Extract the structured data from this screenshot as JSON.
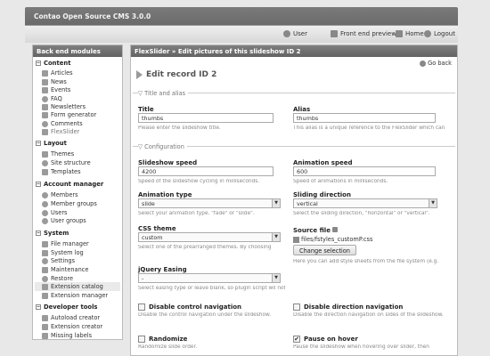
{
  "header": {
    "app_title": "Contao Open Source CMS 3.0.0",
    "nav": [
      {
        "label": "User",
        "icon": "user-icon"
      },
      {
        "label": "Front end preview",
        "icon": "preview-icon"
      },
      {
        "label": "Home",
        "icon": "home-icon"
      },
      {
        "label": "Logout",
        "icon": "logout-icon"
      }
    ]
  },
  "sidebar": {
    "title": "Back end modules",
    "groups": [
      {
        "label": "Content",
        "items": [
          "Articles",
          "News",
          "Events",
          "FAQ",
          "Newsletters",
          "Form generator",
          "Comments",
          "FlexSlider"
        ]
      },
      {
        "label": "Layout",
        "items": [
          "Themes",
          "Site structure",
          "Templates"
        ]
      },
      {
        "label": "Account manager",
        "items": [
          "Members",
          "Member groups",
          "Users",
          "User groups"
        ]
      },
      {
        "label": "System",
        "items": [
          "File manager",
          "System log",
          "Settings",
          "Maintenance",
          "Restore",
          "Extension catalog",
          "Extension manager"
        ]
      },
      {
        "label": "Developer tools",
        "items": [
          "Autoload creator",
          "Extension creator",
          "Missing labels"
        ]
      }
    ]
  },
  "main": {
    "breadcrumb": "FlexSlider » Edit pictures of this slideshow ID 2",
    "go_back": "Go back",
    "edit_title": "Edit record ID 2",
    "sections": {
      "title_alias": "Title and alias",
      "configuration": "Configuration"
    },
    "fields": {
      "title": {
        "label": "Title",
        "value": "thumbs",
        "hint": "Please enter the slideshow title."
      },
      "alias": {
        "label": "Alias",
        "value": "thumbs",
        "hint": "This alias is a unique reference to the FlexSlider which can"
      },
      "slideshow_speed": {
        "label": "Slideshow speed",
        "value": "4200",
        "hint": "Speed of the slideshow cycling in milliseconds."
      },
      "animation_speed": {
        "label": "Animation speed",
        "value": "600",
        "hint": "Speed of animations in milliseconds."
      },
      "animation_type": {
        "label": "Animation type",
        "value": "slide",
        "hint": "Select your animation type. \"fade\" or \"slide\"."
      },
      "sliding_direction": {
        "label": "Sliding direction",
        "value": "vertical",
        "hint": "Select the sliding direction, \"horizontal\" or \"vertical\"."
      },
      "css_theme": {
        "label": "CSS theme",
        "value": "custom",
        "hint": "Select one of the prearranged themes. By choosing"
      },
      "source_file": {
        "label": "Source file",
        "path": "files/fstyles_customP.css",
        "button": "Change selection",
        "hint": "Here you can add style sheets from the file system (e.g."
      },
      "jquery_easing": {
        "label": "jQuery Easing",
        "value": "-",
        "hint": "Select easing type or leave blank, so plugin script wil not"
      },
      "disable_control_nav": {
        "label": "Disable control navigation",
        "checked": false,
        "hint": "Disable the control navigation under the slideshow."
      },
      "disable_direction_nav": {
        "label": "Disable direction navigation",
        "checked": false,
        "hint": "Disable the direction navigation on sides of the slideshow."
      },
      "randomize": {
        "label": "Randomize",
        "checked": false,
        "hint": "Randomize slide order."
      },
      "pause_on_hover": {
        "label": "Pause on hover",
        "checked": true,
        "check_mark": "✔",
        "hint": "Pause the slideshow when hovering over slider, then"
      }
    }
  }
}
